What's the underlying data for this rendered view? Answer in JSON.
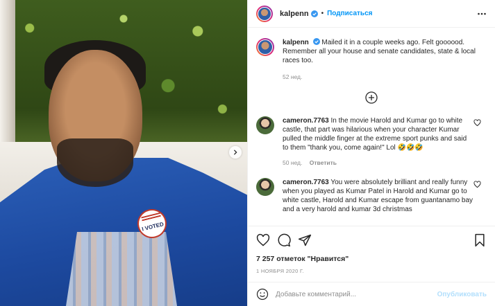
{
  "post": {
    "image_alt": "",
    "sticker_text": "I VOTED"
  },
  "header": {
    "username": "kalpenn",
    "separator": "•",
    "follow_label": "Подписаться"
  },
  "caption": {
    "username": "kalpenn",
    "text": "Mailed it in a couple weeks ago. Felt goooood. Remember all your house and senate candidates, state & local races too.",
    "time": "52 нед."
  },
  "comments": [
    {
      "username": "cameron.7763",
      "text": "In the movie Harold and Kumar go to white castle, that part was hilarious when your character Kumar pulled the middle finger at the extreme sport punks and said to them \"thank you, come again!\" Lol 🤣🤣🤣",
      "time": "50 нед.",
      "reply_label": "Ответить"
    },
    {
      "username": "cameron.7763",
      "text": "You were absolutely brilliant and really funny when you played as Kumar Patel in Harold and Kumar go to white castle, Harold and Kumar escape from guantanamo bay and a very harold and kumar 3d christmas",
      "time": "",
      "reply_label": ""
    }
  ],
  "stats": {
    "likes": "7 257 отметок \"Нравится\"",
    "date": "1 ноября 2020 г."
  },
  "composer": {
    "placeholder": "Добавьте комментарий...",
    "publish_label": "Опубликовать"
  },
  "icons": {
    "verified": "verified-badge-icon",
    "more": "more-options-icon",
    "load_more": "load-more-plus-icon",
    "like": "heart-icon",
    "comment": "comment-bubble-icon",
    "share": "paper-plane-icon",
    "save": "bookmark-icon",
    "emoji": "smiley-icon",
    "carousel_next": "chevron-right-icon"
  },
  "colors": {
    "accent": "#0095f6",
    "publish_disabled": "#b2dffc",
    "muted": "#8e8e8e",
    "text": "#262626"
  }
}
